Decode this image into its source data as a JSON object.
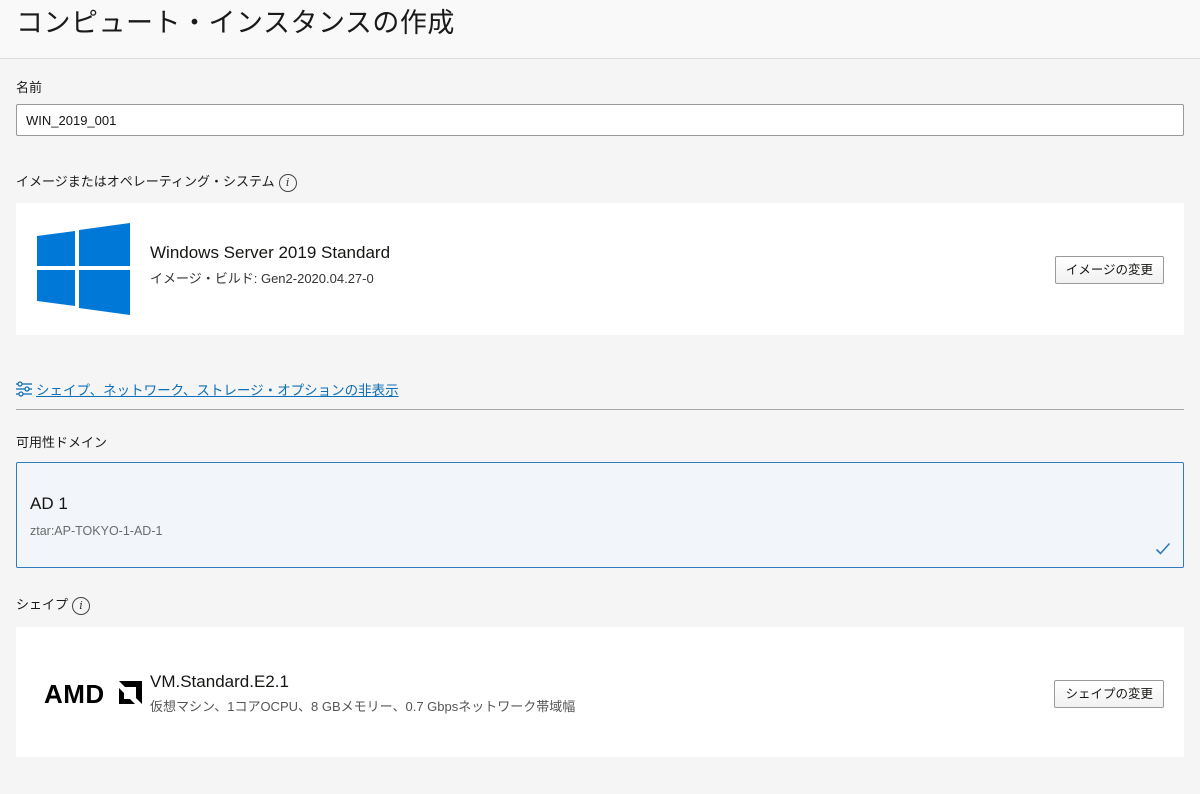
{
  "header": {
    "title": "コンピュート・インスタンスの作成"
  },
  "name_field": {
    "label": "名前",
    "value": "WIN_2019_001"
  },
  "image_section": {
    "label": "イメージまたはオペレーティング・システム",
    "info_icon": "info-icon",
    "logo_icon": "windows-logo-icon",
    "title": "Windows Server 2019 Standard",
    "subtitle": "イメージ・ビルド: Gen2-2020.04.27-0",
    "button_label": "イメージの変更",
    "logo_color": "#0078d7"
  },
  "options_toggle": {
    "icon": "sliders-icon",
    "label": "シェイプ、ネットワーク、ストレージ・オプションの非表示"
  },
  "availability_domain": {
    "label": "可用性ドメイン",
    "selected": {
      "name": "AD 1",
      "subtitle": "ztar:AP-TOKYO-1-AD-1",
      "check_icon": "checkmark-icon"
    }
  },
  "shape_section": {
    "label": "シェイプ",
    "info_icon": "info-icon",
    "logo_icon": "amd-logo-icon",
    "logo_text": "AMD",
    "title": "VM.Standard.E2.1",
    "subtitle": "仮想マシン、1コアOCPU、8 GBメモリー、0.7 Gbpsネットワーク帯域幅",
    "button_label": "シェイプの変更"
  },
  "colors": {
    "link": "#0d6fb8",
    "selected_border": "#2f7bbd",
    "selected_bg": "#f2f6fa",
    "page_bg": "#f5f5f5"
  }
}
